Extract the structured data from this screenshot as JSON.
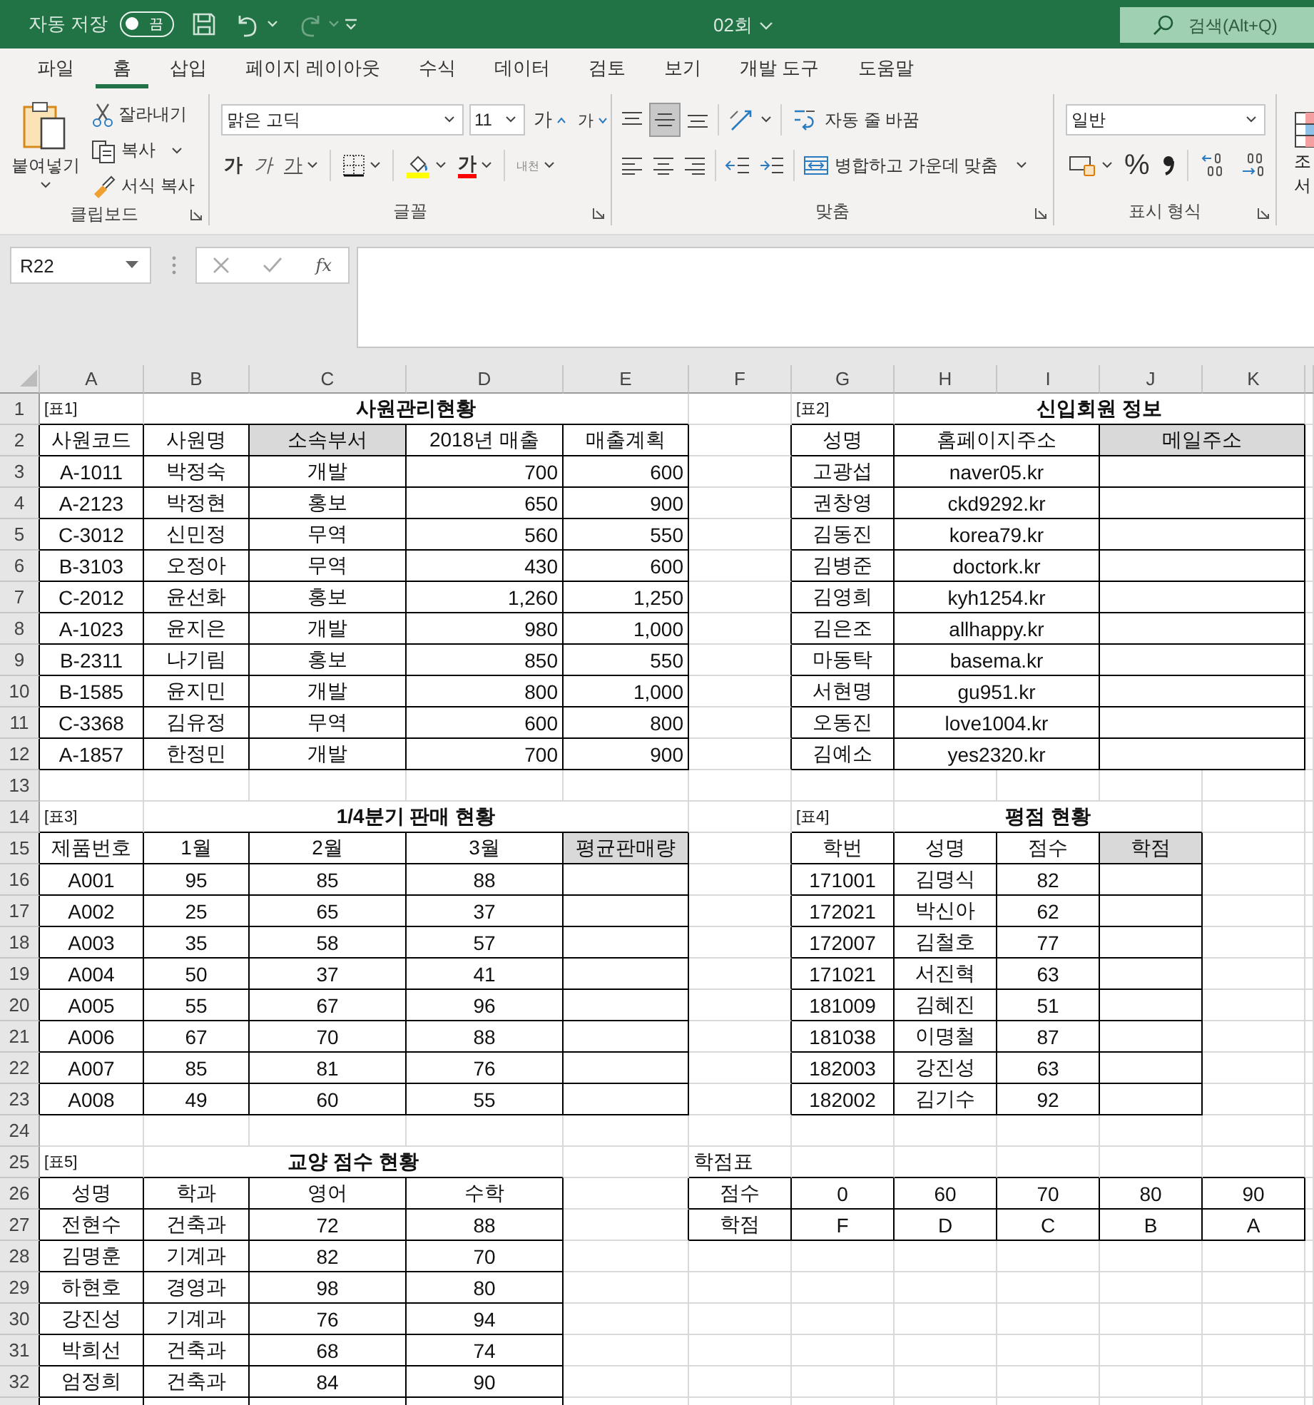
{
  "titlebar": {
    "autosave_label": "자동 저장",
    "autosave_toggle": {
      "label": "끔",
      "on": false
    },
    "redo": {
      "disabled": true
    },
    "file_name": "02회",
    "search": {
      "placeholder": "검색(Alt+Q)"
    }
  },
  "ribbon_tabs": [
    {
      "label": "파일",
      "selected": false
    },
    {
      "label": "홈",
      "selected": true
    },
    {
      "label": "삽입",
      "selected": false
    },
    {
      "label": "페이지 레이아웃",
      "selected": false
    },
    {
      "label": "수식",
      "selected": false
    },
    {
      "label": "데이터",
      "selected": false
    },
    {
      "label": "검토",
      "selected": false
    },
    {
      "label": "보기",
      "selected": false
    },
    {
      "label": "개발 도구",
      "selected": false
    },
    {
      "label": "도움말",
      "selected": false
    }
  ],
  "clipboard": {
    "title": "클립보드",
    "paste": "붙여넣기",
    "cut": "잘라내기",
    "copy": "복사",
    "format_painter": "서식 복사"
  },
  "font": {
    "title": "글꼴",
    "name": "맑은 고딕",
    "size": "11",
    "grow": "가",
    "shrink": "가",
    "bold": "가",
    "italic": "가",
    "underline": "가",
    "font_color": "가",
    "phonetic": "내천"
  },
  "alignment": {
    "title": "맞춤",
    "vertical_align": [
      {
        "selected": false
      },
      {
        "selected": true
      },
      {
        "selected": false
      }
    ],
    "wrap_text": "자동 줄 바꿈",
    "merge_center": "병합하고 가운데 맞춤"
  },
  "number": {
    "title": "표시 형식",
    "format": "일반",
    "percent": "%"
  },
  "styles_cut": {
    "line_1": "조",
    "line_2": "서"
  },
  "formula_bar": {
    "name_box": "R22",
    "function_label": "fx"
  },
  "sheet": {
    "columns": [
      "A",
      "B",
      "C",
      "D",
      "E",
      "F",
      "G",
      "H",
      "I",
      "J",
      "K"
    ],
    "row_numbers": [
      "1",
      "2",
      "3",
      "4",
      "5",
      "6",
      "7",
      "8",
      "9",
      "10",
      "11",
      "12",
      "13",
      "14",
      "15",
      "16",
      "17",
      "18",
      "19",
      "20",
      "21",
      "22",
      "23",
      "24",
      "25",
      "26",
      "27",
      "28",
      "29",
      "30",
      "31",
      "32"
    ],
    "tables": [
      {
        "label": "[표1]",
        "title": "사원관리현황",
        "header": [
          {
            "text": "사원코드",
            "shaded": false
          },
          {
            "text": "사원명",
            "shaded": false
          },
          {
            "text": "소속부서",
            "shaded": true
          },
          {
            "text": "2018년 매출",
            "shaded": false
          },
          {
            "text": "매출계획",
            "shaded": false
          }
        ],
        "rows": [
          [
            "A-1011",
            "박정숙",
            "개발",
            "700",
            "600"
          ],
          [
            "A-2123",
            "박정현",
            "홍보",
            "650",
            "900"
          ],
          [
            "C-3012",
            "신민정",
            "무역",
            "560",
            "550"
          ],
          [
            "B-3103",
            "오정아",
            "무역",
            "430",
            "600"
          ],
          [
            "C-2012",
            "윤선화",
            "홍보",
            "1,260",
            "1,250"
          ],
          [
            "A-1023",
            "윤지은",
            "개발",
            "980",
            "1,000"
          ],
          [
            "B-2311",
            "나기림",
            "홍보",
            "850",
            "550"
          ],
          [
            "B-1585",
            "윤지민",
            "개발",
            "800",
            "1,000"
          ],
          [
            "C-3368",
            "김유정",
            "무역",
            "600",
            "800"
          ],
          [
            "A-1857",
            "한정민",
            "개발",
            "700",
            "900"
          ]
        ]
      },
      {
        "label": "[표2]",
        "title": "신입회원 정보",
        "header": [
          {
            "text": "성명",
            "shaded": false
          },
          {
            "text": "홈페이지주소",
            "shaded": false
          },
          {
            "text": "메일주소",
            "shaded": true
          }
        ],
        "rows": [
          [
            "고광섭",
            "naver05.kr"
          ],
          [
            "권창영",
            "ckd9292.kr"
          ],
          [
            "김동진",
            "korea79.kr"
          ],
          [
            "김병준",
            "doctork.kr"
          ],
          [
            "김영희",
            "kyh1254.kr"
          ],
          [
            "김은조",
            "allhappy.kr"
          ],
          [
            "마동탁",
            "basema.kr"
          ],
          [
            "서현명",
            "gu951.kr"
          ],
          [
            "오동진",
            "love1004.kr"
          ],
          [
            "김예소",
            "yes2320.kr"
          ]
        ]
      },
      {
        "label": "[표3]",
        "title": "1/4분기 판매 현황",
        "header": [
          {
            "text": "제품번호",
            "shaded": false
          },
          {
            "text": "1월",
            "shaded": false
          },
          {
            "text": "2월",
            "shaded": false
          },
          {
            "text": "3월",
            "shaded": false
          },
          {
            "text": "평균판매량",
            "shaded": true
          }
        ],
        "rows": [
          [
            "A001",
            "95",
            "85",
            "88"
          ],
          [
            "A002",
            "25",
            "65",
            "37"
          ],
          [
            "A003",
            "35",
            "58",
            "57"
          ],
          [
            "A004",
            "50",
            "37",
            "41"
          ],
          [
            "A005",
            "55",
            "67",
            "96"
          ],
          [
            "A006",
            "67",
            "70",
            "88"
          ],
          [
            "A007",
            "85",
            "81",
            "76"
          ],
          [
            "A008",
            "49",
            "60",
            "55"
          ]
        ]
      },
      {
        "label": "[표4]",
        "title": "평점 현황",
        "header": [
          {
            "text": "학번",
            "shaded": false
          },
          {
            "text": "성명",
            "shaded": false
          },
          {
            "text": "점수",
            "shaded": false
          },
          {
            "text": "학점",
            "shaded": true
          }
        ],
        "rows": [
          [
            "171001",
            "김명식",
            "82"
          ],
          [
            "172021",
            "박신아",
            "62"
          ],
          [
            "172007",
            "김철호",
            "77"
          ],
          [
            "171021",
            "서진혁",
            "63"
          ],
          [
            "181009",
            "김혜진",
            "51"
          ],
          [
            "181038",
            "이명철",
            "87"
          ],
          [
            "182003",
            "강진성",
            "63"
          ],
          [
            "182002",
            "김기수",
            "92"
          ]
        ]
      },
      {
        "label": "[표5]",
        "title": "교양 점수 현황",
        "header": [
          {
            "text": "성명",
            "shaded": false
          },
          {
            "text": "학과",
            "shaded": false
          },
          {
            "text": "영어",
            "shaded": false
          },
          {
            "text": "수학",
            "shaded": false
          }
        ],
        "rows": [
          [
            "전현수",
            "건축과",
            "72",
            "88"
          ],
          [
            "김명훈",
            "기계과",
            "82",
            "70"
          ],
          [
            "하현호",
            "경영과",
            "98",
            "80"
          ],
          [
            "강진성",
            "기계과",
            "76",
            "94"
          ],
          [
            "박희선",
            "건축과",
            "68",
            "74"
          ],
          [
            "엄정희",
            "건축과",
            "84",
            "90"
          ]
        ]
      },
      {
        "title": "학점표",
        "rows": [
          [
            "점수",
            "0",
            "60",
            "70",
            "80",
            "90"
          ],
          [
            "학점",
            "F",
            "D",
            "C",
            "B",
            "A"
          ]
        ]
      }
    ]
  }
}
